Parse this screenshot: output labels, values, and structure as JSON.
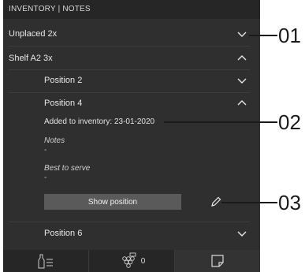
{
  "header": {
    "title": "INVENTORY | NOTES"
  },
  "rows": {
    "unplaced": "Unplaced 2x",
    "shelf": "Shelf A2 3x",
    "position2": "Position 2",
    "position4": "Position 4",
    "position6": "Position 6"
  },
  "details": {
    "added": "Added to inventory: 23-01-2020",
    "notes_label": "Notes",
    "notes_value": "-",
    "best_label": "Best to serve",
    "best_value": "-"
  },
  "actions": {
    "show_position": "Show position"
  },
  "tabs": {
    "bottles_icon": "bottle-list-icon",
    "grapes_icon": "grapes-icon",
    "grapes_count": "0",
    "notes_icon": "note-icon"
  },
  "callouts": {
    "c1": "01",
    "c2": "02",
    "c3": "03"
  },
  "colors": {
    "panel": "#2f2f2f",
    "header": "#262626",
    "button": "#5a5a5a"
  }
}
